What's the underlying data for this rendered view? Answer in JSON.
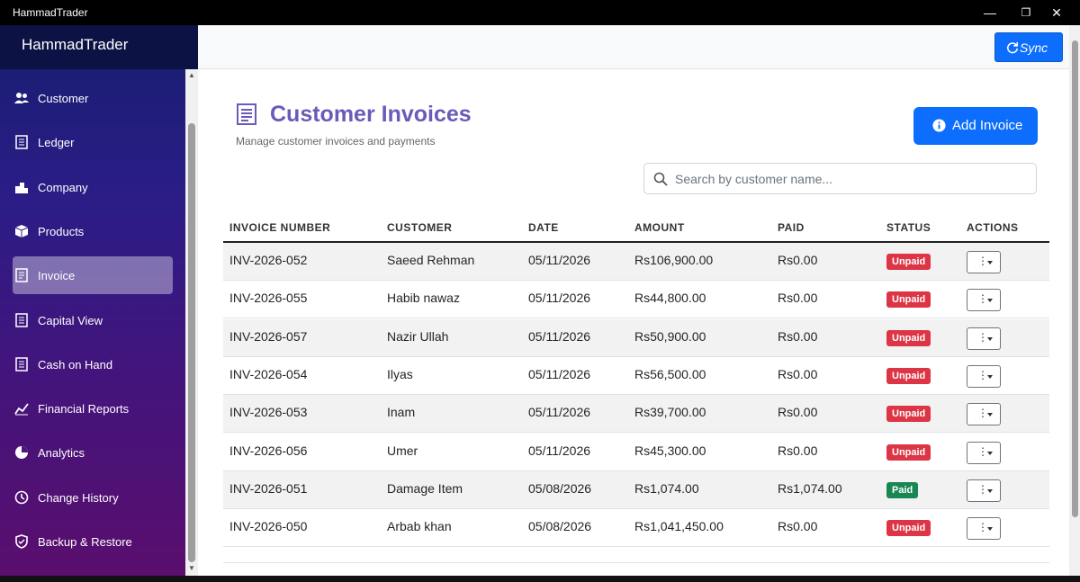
{
  "window": {
    "title": "HammadTrader",
    "minimize": "—",
    "maximize": "❐",
    "close": "✕"
  },
  "sidebar": {
    "brand": "HammadTrader",
    "items": [
      {
        "label": "Customer",
        "icon": "users-icon"
      },
      {
        "label": "Ledger",
        "icon": "ledger-icon"
      },
      {
        "label": "Company",
        "icon": "building-icon"
      },
      {
        "label": "Products",
        "icon": "box-icon"
      },
      {
        "label": "Invoice",
        "icon": "invoice-icon",
        "active": true
      },
      {
        "label": "Capital View",
        "icon": "capital-icon"
      },
      {
        "label": "Cash on Hand",
        "icon": "cash-icon"
      },
      {
        "label": "Financial Reports",
        "icon": "chart-line-icon"
      },
      {
        "label": "Analytics",
        "icon": "pie-chart-icon"
      },
      {
        "label": "Change History",
        "icon": "history-icon"
      },
      {
        "label": "Backup & Restore",
        "icon": "shield-icon"
      }
    ]
  },
  "topbar": {
    "sync_label": "Sync"
  },
  "page": {
    "title": "Customer Invoices",
    "subtitle": "Manage customer invoices and payments",
    "add_label": "Add Invoice",
    "search_placeholder": "Search by customer name..."
  },
  "table": {
    "headers": [
      "INVOICE NUMBER",
      "CUSTOMER",
      "DATE",
      "AMOUNT",
      "PAID",
      "STATUS",
      "ACTIONS"
    ],
    "rows": [
      {
        "invoice": "INV-2026-052",
        "customer": "Saeed Rehman",
        "date": "05/11/2026",
        "amount": "Rs106,900.00",
        "paid": "Rs0.00",
        "status": "Unpaid"
      },
      {
        "invoice": "INV-2026-055",
        "customer": "Habib nawaz",
        "date": "05/11/2026",
        "amount": "Rs44,800.00",
        "paid": "Rs0.00",
        "status": "Unpaid"
      },
      {
        "invoice": "INV-2026-057",
        "customer": "Nazir Ullah",
        "date": "05/11/2026",
        "amount": "Rs50,900.00",
        "paid": "Rs0.00",
        "status": "Unpaid"
      },
      {
        "invoice": "INV-2026-054",
        "customer": "Ilyas",
        "date": "05/11/2026",
        "amount": "Rs56,500.00",
        "paid": "Rs0.00",
        "status": "Unpaid"
      },
      {
        "invoice": "INV-2026-053",
        "customer": "Inam",
        "date": "05/11/2026",
        "amount": "Rs39,700.00",
        "paid": "Rs0.00",
        "status": "Unpaid"
      },
      {
        "invoice": "INV-2026-056",
        "customer": "Umer",
        "date": "05/11/2026",
        "amount": "Rs45,300.00",
        "paid": "Rs0.00",
        "status": "Unpaid"
      },
      {
        "invoice": "INV-2026-051",
        "customer": "Damage Item",
        "date": "05/08/2026",
        "amount": "Rs1,074.00",
        "paid": "Rs1,074.00",
        "status": "Paid"
      },
      {
        "invoice": "INV-2026-050",
        "customer": "Arbab khan",
        "date": "05/08/2026",
        "amount": "Rs1,041,450.00",
        "paid": "Rs0.00",
        "status": "Unpaid"
      }
    ]
  },
  "colors": {
    "accent": "#0d6efd",
    "title": "#6a5bb8",
    "unpaid": "#dc3545",
    "paid": "#198754"
  }
}
